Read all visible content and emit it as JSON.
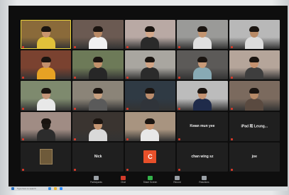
{
  "meeting": {
    "tiles": [
      {
        "name": "",
        "kind": "video",
        "bg": "#8a6a3a",
        "skin": "#c9956e",
        "shirt": "#e0c13a",
        "active": true
      },
      {
        "name": "",
        "kind": "video",
        "bg": "#6b5a52",
        "skin": "#b98a66",
        "shirt": "#f1f1f1"
      },
      {
        "name": "",
        "kind": "video",
        "bg": "#b9a9a4",
        "skin": "#d3a78a",
        "shirt": "#2a2a2a"
      },
      {
        "name": "",
        "kind": "video",
        "bg": "#9a9a98",
        "skin": "#c29470",
        "shirt": "#e0e0e0"
      },
      {
        "name": "",
        "kind": "video",
        "bg": "#b8b8b8",
        "skin": "#b88a66",
        "shirt": "#dcdcdc"
      },
      {
        "name": "",
        "kind": "video",
        "bg": "#7a4230",
        "skin": "#c3906c",
        "shirt": "#e6a224"
      },
      {
        "name": "",
        "kind": "video",
        "bg": "#6d7a58",
        "skin": "#c1916b",
        "shirt": "#272727"
      },
      {
        "name": "",
        "kind": "video",
        "bg": "#a9a6a0",
        "skin": "#d1a384",
        "shirt": "#2b2b2b"
      },
      {
        "name": "",
        "kind": "video",
        "bg": "#5c5a58",
        "skin": "#c79a78",
        "shirt": "#88aab4"
      },
      {
        "name": "",
        "kind": "video",
        "bg": "#b5a59a",
        "skin": "#c49270",
        "shirt": "#3e3e3e"
      },
      {
        "name": "",
        "kind": "video",
        "bg": "#7e8a6e",
        "skin": "#c5967a",
        "shirt": "#e8e8e8"
      },
      {
        "name": "",
        "kind": "video",
        "bg": "#8b8478",
        "skin": "#c8a080",
        "shirt": "#5a5a5a"
      },
      {
        "name": "",
        "kind": "video",
        "bg": "#2f3a44",
        "skin": "#ba8c6c",
        "shirt": "#30343a"
      },
      {
        "name": "",
        "kind": "video",
        "bg": "#bcbcbc",
        "skin": "#c39271",
        "shirt": "#1f2b4a"
      },
      {
        "name": "",
        "kind": "video",
        "bg": "#7b6a5e",
        "skin": "#b78a68",
        "shirt": "#5a4a40"
      },
      {
        "name": "",
        "kind": "video",
        "bg": "#a08c84",
        "skin": "#1d1915",
        "shirt": "#2c2c2c"
      },
      {
        "name": "",
        "kind": "video",
        "bg": "#3a3430",
        "skin": "#c59673",
        "shirt": "#d9d9d9"
      },
      {
        "name": "",
        "kind": "video",
        "bg": "#a89480",
        "skin": "#c6936f",
        "shirt": "#e8e8e8"
      },
      {
        "name": "Kwan mun yee",
        "kind": "name"
      },
      {
        "name": "iPad 和 Leung...",
        "kind": "name"
      },
      {
        "name": "",
        "kind": "thumb"
      },
      {
        "name": "Nick",
        "kind": "name"
      },
      {
        "name": "",
        "kind": "avatar",
        "letter": "C"
      },
      {
        "name": "chan wing sz",
        "kind": "name"
      },
      {
        "name": "joe",
        "kind": "name"
      }
    ]
  },
  "toolbar": {
    "items": [
      {
        "label": "Participants",
        "icon": "participants-icon",
        "color": "#9aa0a6"
      },
      {
        "label": "Chat",
        "icon": "chat-icon",
        "color": "#d33b2b"
      },
      {
        "label": "Share Screen",
        "icon": "share-screen-icon",
        "color": "#33b24a"
      },
      {
        "label": "Record",
        "icon": "record-icon",
        "color": "#9aa0a6"
      },
      {
        "label": "Reactions",
        "icon": "reactions-icon",
        "color": "#9aa0a6"
      }
    ]
  },
  "taskbar": {
    "search_placeholder": "Type here to search"
  }
}
